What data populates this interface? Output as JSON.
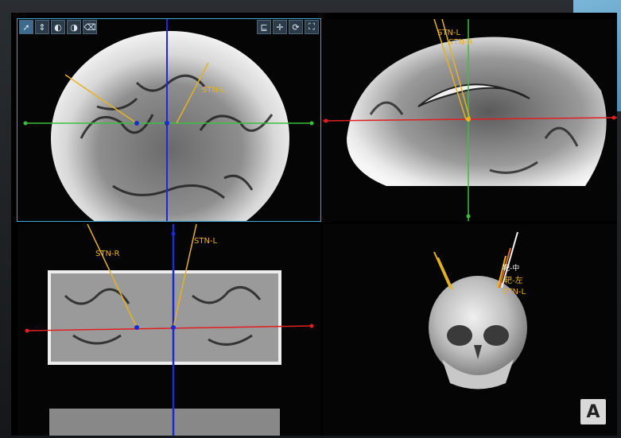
{
  "app": {
    "accent": "#38a9d6",
    "crosshair_colors": {
      "axial_vertical": "#1a2bd6",
      "axial_horizontal": "#3bbf3b",
      "sagittal_horizontal": "#e02020",
      "sagittal_vertical": "#3bbf3b",
      "coronal_horizontal": "#e02020",
      "coronal_vertical": "#1a2bd6"
    },
    "trajectory_color": "#e6b21f"
  },
  "toolbar": {
    "left_tools": [
      {
        "icon": "pointer-icon",
        "glyph": "➚"
      },
      {
        "icon": "pan-icon",
        "glyph": "⇕"
      },
      {
        "icon": "rotate-icon",
        "glyph": "◐"
      },
      {
        "icon": "window-level-icon",
        "glyph": "◑"
      },
      {
        "icon": "eraser-icon",
        "glyph": "⌫"
      }
    ],
    "right_tools": [
      {
        "icon": "measure-icon",
        "glyph": "⊑"
      },
      {
        "icon": "crosshair-icon",
        "glyph": "✛"
      },
      {
        "icon": "reset-icon",
        "glyph": "⟳"
      },
      {
        "icon": "fullscreen-icon",
        "glyph": "⛶"
      }
    ]
  },
  "axial": {
    "labels": {
      "stn_l": "STN-L"
    }
  },
  "sagittal": {
    "labels": {
      "stn_l": "STN-L",
      "stn_r": "STN-R"
    }
  },
  "coronal": {
    "labels": {
      "stn_r": "STN-R",
      "stn_l": "STN-L"
    }
  },
  "render3d": {
    "labels": {
      "target_mid": "靶-中",
      "target_left": "靶-左",
      "stn_l": "STN-L"
    },
    "orientation_badge": "A"
  }
}
